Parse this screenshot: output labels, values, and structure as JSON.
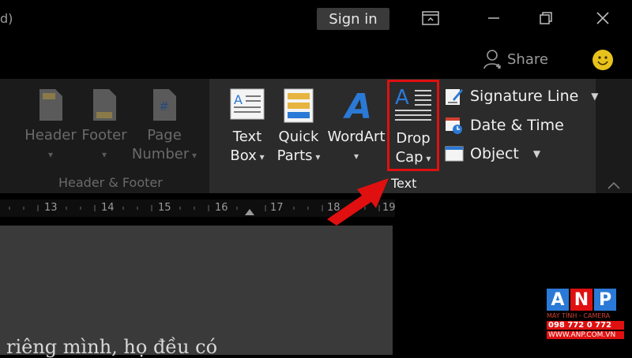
{
  "titlebar": {
    "title_fragment": "d)",
    "sign_in_label": "Sign in",
    "share_label": "Share"
  },
  "ribbon": {
    "header_footer_group": {
      "label": "Header & Footer",
      "buttons": [
        {
          "line1": "Header",
          "line2": ""
        },
        {
          "line1": "Footer",
          "line2": ""
        },
        {
          "line1": "Page",
          "line2": "Number"
        }
      ]
    },
    "text_group": {
      "label": "Text",
      "buttons": [
        {
          "line1": "Text",
          "line2": "Box"
        },
        {
          "line1": "Quick",
          "line2": "Parts"
        },
        {
          "line1": "WordArt",
          "line2": ""
        },
        {
          "line1": "Drop",
          "line2": "Cap"
        }
      ],
      "side_items": [
        {
          "label": "Signature Line"
        },
        {
          "label": "Date & Time"
        },
        {
          "label": "Object"
        }
      ]
    }
  },
  "ruler": {
    "ticks": [
      "13",
      "14",
      "15",
      "16",
      "17",
      "18",
      "19"
    ]
  },
  "document": {
    "visible_text": "riêng mình, họ đều có"
  },
  "watermark": {
    "letters": [
      "A",
      "N",
      "P"
    ],
    "tagline": "MÁY TÍNH - CAMERA",
    "phone": "098 772 0 772",
    "website": "WWW.ANP.COM.VN"
  },
  "colors": {
    "highlight": "#e01010",
    "arrow": "#e01010",
    "accent_blue": "#2b79d6"
  },
  "icons": [
    "restore-ribbon-icon",
    "minimize-icon",
    "maximize-icon",
    "close-icon",
    "person-icon",
    "smiley-icon",
    "header-icon",
    "footer-icon",
    "page-number-icon",
    "text-box-icon",
    "quick-parts-icon",
    "wordart-icon",
    "drop-cap-icon",
    "signature-line-icon",
    "date-time-icon",
    "object-icon",
    "collapse-ribbon-icon"
  ]
}
